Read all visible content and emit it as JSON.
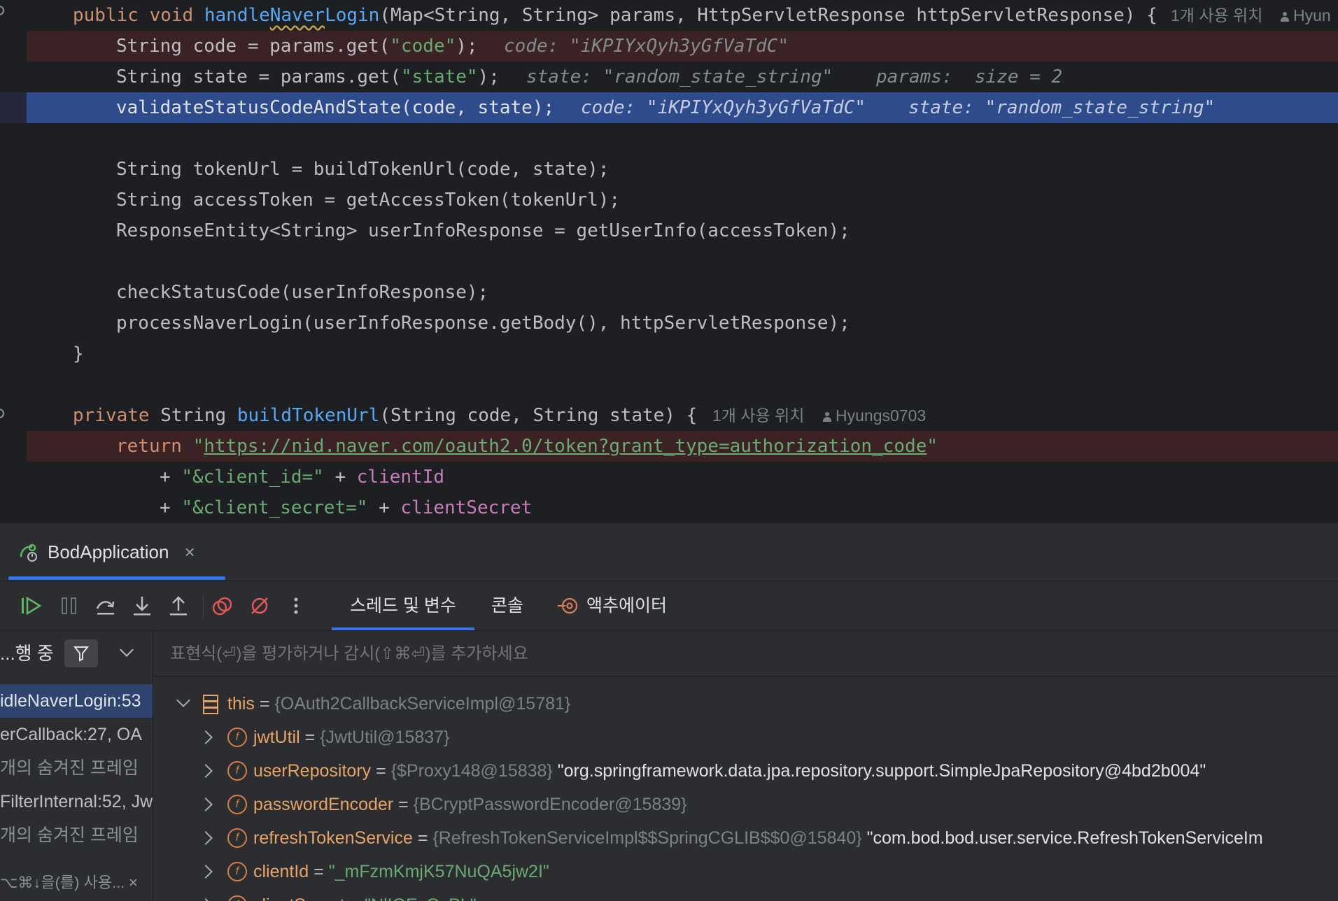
{
  "editor": {
    "lines": {
      "l1": {
        "kw1": "public",
        "kw2": "void",
        "fn": "handleNaverLogin",
        "rest": "(Map<String, String> params, HttpServletResponse httpServletResponse) {",
        "hint": "1개 사용 위치",
        "author": "Hyun"
      },
      "l2": {
        "code": "String code = params.get(",
        "s": "\"code\"",
        "end": ");",
        "inline": "code: \"iKPIYxQyh3yGfVaTdC\""
      },
      "l3": {
        "code": "String state = params.get(",
        "s": "\"state\"",
        "end": ");",
        "inline1": "state: \"random_state_string\"",
        "inline2": "params:  size = 2"
      },
      "l4": {
        "code": "validateStatusCodeAndState(code, state);",
        "inline1": "code: \"iKPIYxQyh3yGfVaTdC\"",
        "inline2": "state: \"random_state_string\""
      },
      "l6": "String tokenUrl = buildTokenUrl(code, state);",
      "l7": "String accessToken = getAccessToken(tokenUrl);",
      "l8": "ResponseEntity<String> userInfoResponse = getUserInfo(accessToken);",
      "l10": "checkStatusCode(userInfoResponse);",
      "l11": "processNaverLogin(userInfoResponse.getBody(), httpServletResponse);",
      "l12": "}",
      "l14": {
        "kw": "private",
        "type": "String",
        "fn": "buildTokenUrl",
        "rest": "(String code, String state) {",
        "hint": "1개 사용 위치",
        "author": "Hyungs0703"
      },
      "l15": {
        "kw": "return",
        "q1": "\"",
        "url": "https://nid.naver.com/oauth2.0/token?grant_type=authorization_code",
        "q2": "\""
      },
      "l16": {
        "op": "+",
        "s": "\"&client_id=\"",
        "op2": "+",
        "fld": "clientId"
      },
      "l17": {
        "op": "+",
        "s": "\"&client_secret=\"",
        "op2": "+",
        "fld": "clientSecret"
      }
    }
  },
  "run_tab": {
    "label": "BodApplication",
    "close": "×"
  },
  "debug_tabs": {
    "threads": "스레드 및 변수",
    "console": "콘솔",
    "actuator": "액추에이터"
  },
  "frames_panel": {
    "status": "...행 중",
    "items": [
      "idleNaverLogin:53",
      "erCallback:27, OA",
      "개의 숨겨진 프레임",
      "FilterInternal:52, Jw",
      "개의 숨겨진 프레임"
    ],
    "hint": "⌥⌘↓을(를) 사용..."
  },
  "evaluate": {
    "placeholder": "표현식(⏎)을 평가하거나 감시(⇧⌘⏎)를 추가하세요"
  },
  "variables": [
    {
      "name": "this",
      "eq": "=",
      "type": "{OAuth2CallbackServiceImpl@15781}",
      "val": ""
    },
    {
      "name": "jwtUtil",
      "eq": "=",
      "type": "{JwtUtil@15837}",
      "val": ""
    },
    {
      "name": "userRepository",
      "eq": "=",
      "type": "{$Proxy148@15838}",
      "val": "\"org.springframework.data.jpa.repository.support.SimpleJpaRepository@4bd2b004\""
    },
    {
      "name": "passwordEncoder",
      "eq": "=",
      "type": "{BCryptPasswordEncoder@15839}",
      "val": ""
    },
    {
      "name": "refreshTokenService",
      "eq": "=",
      "type": "{RefreshTokenServiceImpl$$SpringCGLIB$$0@15840}",
      "val": "\"com.bod.bod.user.service.RefreshTokenServiceIm"
    },
    {
      "name": "clientId",
      "eq": "=",
      "type": "",
      "val": "\"_mFzmKmjK57NuQA5jw2I\""
    },
    {
      "name": "clientSecret",
      "eq": "=",
      "type": "",
      "val": "\"NlIOExQyPL\""
    }
  ],
  "icon_names": [
    "resume-icon",
    "pause-icon",
    "step-over-icon",
    "step-into-icon",
    "step-out-icon",
    "view-breakpoints-icon",
    "mute-breakpoints-icon",
    "more-icon",
    "filter-icon",
    "chevron-down-icon",
    "actuator-icon",
    "field-icon",
    "object-icon",
    "run-app-icon",
    "close-icon"
  ],
  "colors": {
    "editor_bg": "#1e1f22",
    "panel_bg": "#2b2d30",
    "exec_line": "#2e4b8c",
    "breakpoint_line": "#3a2225",
    "accent": "#3574f0"
  }
}
